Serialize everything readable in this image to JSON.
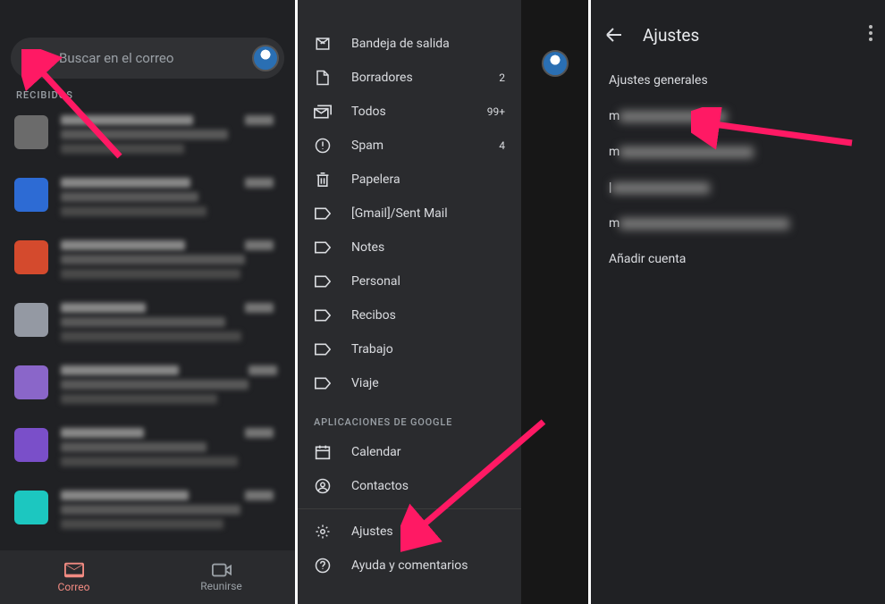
{
  "panel1": {
    "search_placeholder": "Buscar en el correo",
    "section_label": "RECIBIDOS",
    "bottom_nav": {
      "mail": "Correo",
      "meet": "Reunirse"
    },
    "avatars_colors": [
      "#6b6b6b",
      "#2d6bd4",
      "#d44a2d",
      "#9499a3",
      "#8a66c9",
      "#7a4fc9",
      "#1cc7c0"
    ]
  },
  "panel2": {
    "items": [
      {
        "icon": "outbox",
        "label": "Bandeja de salida",
        "count": ""
      },
      {
        "icon": "draft",
        "label": "Borradores",
        "count": "2"
      },
      {
        "icon": "all",
        "label": "Todos",
        "count": "99+"
      },
      {
        "icon": "spam",
        "label": "Spam",
        "count": "4"
      },
      {
        "icon": "trash",
        "label": "Papelera",
        "count": ""
      },
      {
        "icon": "label",
        "label": "[Gmail]/Sent Mail",
        "count": ""
      },
      {
        "icon": "label",
        "label": "Notes",
        "count": ""
      },
      {
        "icon": "label",
        "label": "Personal",
        "count": ""
      },
      {
        "icon": "label",
        "label": "Recibos",
        "count": ""
      },
      {
        "icon": "label",
        "label": "Trabajo",
        "count": ""
      },
      {
        "icon": "label",
        "label": "Viaje",
        "count": ""
      }
    ],
    "section_apps": "APLICACIONES DE GOOGLE",
    "apps": [
      {
        "icon": "calendar",
        "label": "Calendar"
      },
      {
        "icon": "contacts",
        "label": "Contactos"
      }
    ],
    "footer": [
      {
        "icon": "settings",
        "label": "Ajustes"
      },
      {
        "icon": "help",
        "label": "Ayuda y comentarios"
      }
    ]
  },
  "panel3": {
    "title": "Ajustes",
    "items": [
      {
        "label": "Ajustes generales"
      },
      {
        "label": "m",
        "blur": 120
      },
      {
        "label": "m",
        "blur": 150
      },
      {
        "label": "|",
        "blur": 110
      },
      {
        "label": "m",
        "blur": 190
      },
      {
        "label": "Añadir cuenta"
      }
    ]
  },
  "arrows_color": "#ff1964"
}
